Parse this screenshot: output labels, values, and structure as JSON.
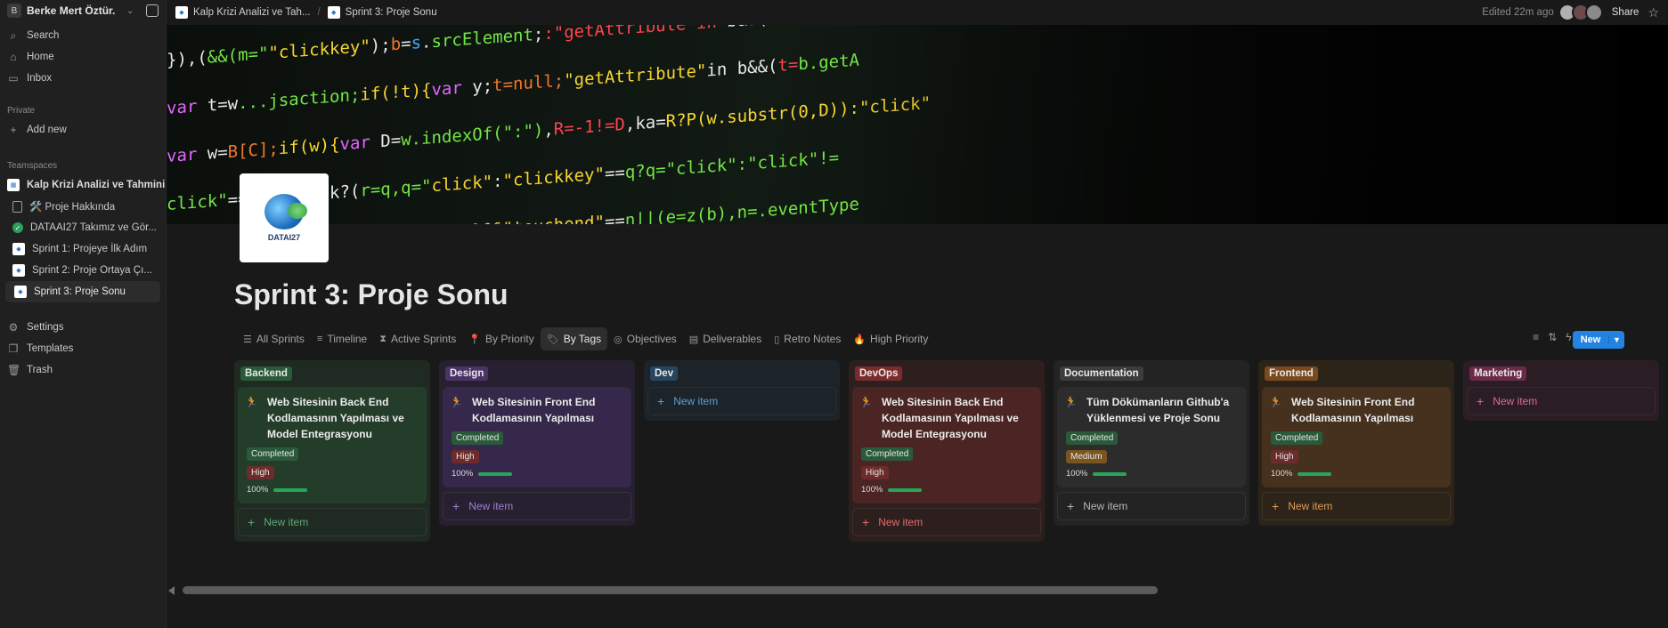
{
  "workspace": {
    "initial": "B",
    "name": "Berke Mert Öztür..."
  },
  "sidebar": {
    "search": "Search",
    "home": "Home",
    "inbox": "Inbox",
    "private_label": "Private",
    "add_new": "Add new",
    "teamspaces_label": "Teamspaces",
    "teamspace_name": "Kalp Krizi Analizi ve Tahmini",
    "pages": [
      {
        "label": "🛠️ Proje Hakkında"
      },
      {
        "label": "DATAAI27 Takımız ve Gör..."
      },
      {
        "label": "Sprint 1: Projeye İlk Adım"
      },
      {
        "label": "Sprint 2: Proje Ortaya Çı..."
      },
      {
        "label": "Sprint 3: Proje Sonu"
      }
    ],
    "settings": "Settings",
    "templates": "Templates",
    "trash": "Trash"
  },
  "breadcrumb": {
    "parent": "Kalp Krizi Analizi ve Tah...",
    "current": "Sprint 3: Proje Sonu"
  },
  "topbar": {
    "edited": "Edited 22m ago",
    "share": "Share"
  },
  "logo_text": "DATAI27",
  "page_title": "Sprint 3: Proje Sonu",
  "tabs": [
    "All Sprints",
    "Timeline",
    "Active Sprints",
    "By Priority",
    "By Tags",
    "Objectives",
    "Deliverables",
    "Retro Notes",
    "High Priority"
  ],
  "active_tab": "By Tags",
  "new_button": "New",
  "columns": [
    {
      "tag": "Backend",
      "tag_color": "#2b5a3a",
      "bg": "#1f2b22",
      "card_bg": "#243d2b",
      "accent": "#5fa876",
      "cards": [
        {
          "title": "Web Sitesinin Back End Kodlamasının Yapılması ve Model Entegrasyonu",
          "status": "Completed",
          "priority": "High",
          "progress": "100%"
        }
      ],
      "new_item": "New item"
    },
    {
      "tag": "Design",
      "tag_color": "#4b3366",
      "bg": "#262030",
      "card_bg": "#35284a",
      "accent": "#a07cd0",
      "cards": [
        {
          "title": "Web Sitesinin Front End Kodlamasının Yapılması",
          "status": "Completed",
          "priority": "High",
          "progress": "100%"
        }
      ],
      "new_item": "New item"
    },
    {
      "tag": "Dev",
      "tag_color": "#28455e",
      "bg": "#1c2329",
      "card_bg": "#1c2329",
      "accent": "#5aa0d8",
      "cards": [],
      "new_item": "New item"
    },
    {
      "tag": "DevOps",
      "tag_color": "#7a2c2c",
      "bg": "#2e1f1f",
      "card_bg": "#4a2524",
      "accent": "#e06a6a",
      "cards": [
        {
          "title": "Web Sitesinin Back End Kodlamasının Yapılması ve Model Entegrasyonu",
          "status": "Completed",
          "priority": "High",
          "progress": "100%"
        }
      ],
      "new_item": "New item"
    },
    {
      "tag": "Documentation",
      "tag_color": "#3c3c3c",
      "bg": "#232323",
      "card_bg": "#2c2c2c",
      "accent": "#b5b5b5",
      "cards": [
        {
          "title": "Tüm Dökümanların Github'a Yüklenmesi ve Proje Sonu",
          "status": "Completed",
          "priority": "Medium",
          "progress": "100%"
        }
      ],
      "new_item": "New item"
    },
    {
      "tag": "Frontend",
      "tag_color": "#7a4a1f",
      "bg": "#2d2419",
      "card_bg": "#45311e",
      "accent": "#e09a56",
      "cards": [
        {
          "title": "Web Sitesinin Front End Kodlamasının Yapılması",
          "status": "Completed",
          "priority": "High",
          "progress": "100%"
        }
      ],
      "new_item": "New item"
    },
    {
      "tag": "Marketing",
      "tag_color": "#6a2a48",
      "bg": "#2a1e24",
      "card_bg": "#2a1e24",
      "accent": "#e0669e",
      "cards": [],
      "new_item": "New item"
    }
  ],
  "pill_colors": {
    "Completed": "#2b5a3a",
    "High": "#6e2b2b",
    "Medium": "#7a5520"
  }
}
